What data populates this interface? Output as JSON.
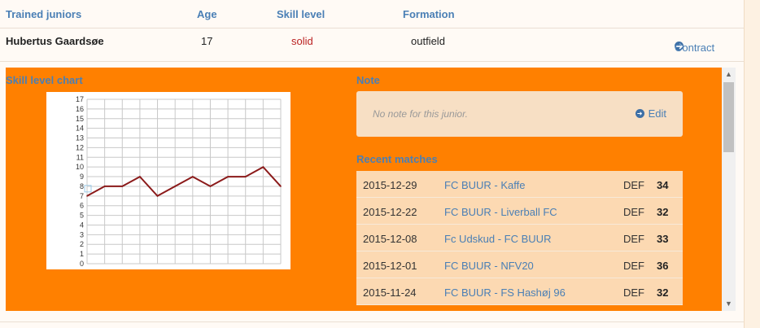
{
  "table": {
    "headers": {
      "juniors": "Trained juniors",
      "age": "Age",
      "skill": "Skill level",
      "formation": "Formation"
    },
    "junior": {
      "name": "Hubertus Gaardsøe",
      "age": "17",
      "skill": "solid",
      "formation": "outfield",
      "contract_label": "Contract"
    }
  },
  "panel": {
    "chart_title": "Skill level chart",
    "note_title": "Note",
    "note_text": "No note for this junior.",
    "edit_label": "Edit",
    "matches_title": "Recent matches",
    "matches": [
      {
        "date": "2015-12-29",
        "name": "FC BUUR - Kaffe",
        "pos": "DEF",
        "score": "34"
      },
      {
        "date": "2015-12-22",
        "name": "FC BUUR - Liverball FC",
        "pos": "DEF",
        "score": "32"
      },
      {
        "date": "2015-12-08",
        "name": "Fc Udskud - FC BUUR",
        "pos": "DEF",
        "score": "33"
      },
      {
        "date": "2015-12-01",
        "name": "FC BUUR - NFV20",
        "pos": "DEF",
        "score": "36"
      },
      {
        "date": "2015-11-24",
        "name": "FC BUUR - FS Hashøj 96",
        "pos": "DEF",
        "score": "32"
      }
    ]
  },
  "chart_data": {
    "type": "line",
    "title": "",
    "xlabel": "",
    "ylabel": "",
    "ylim": [
      0,
      17
    ],
    "yticks": [
      "0",
      "1",
      "2",
      "3",
      "4",
      "5",
      "6",
      "7",
      "8",
      "9",
      "10",
      "11",
      "12",
      "13",
      "14",
      "15",
      "16",
      "17"
    ],
    "grid": true,
    "series": [
      {
        "values": [
          7,
          8,
          8,
          9,
          7,
          8,
          9,
          8,
          9,
          9,
          10,
          8
        ],
        "color": "#8b1a1a"
      }
    ]
  },
  "colors": {
    "panel_bg": "#ff8000",
    "link": "#4a7fb5",
    "skill_text": "#b22222"
  }
}
